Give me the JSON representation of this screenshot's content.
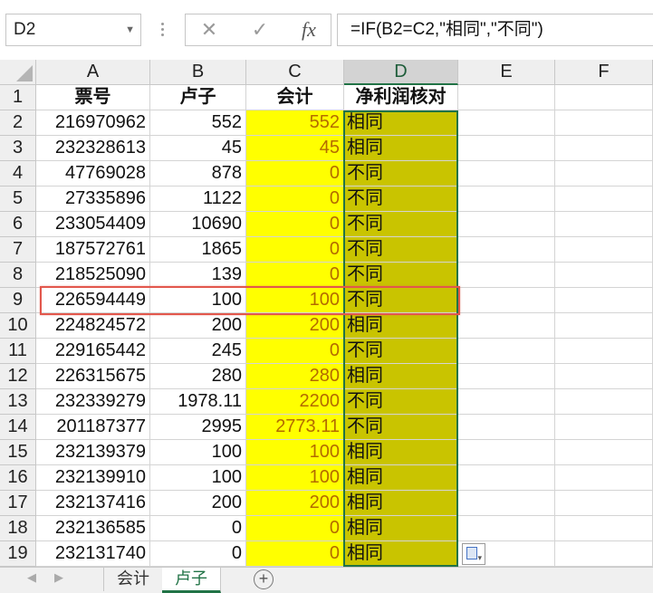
{
  "name_box": "D2",
  "formula_buttons": {
    "cancel": "✕",
    "enter": "✓",
    "fx": "fx"
  },
  "formula": "=IF(B2=C2,\"相同\",\"不同\")",
  "columns": [
    "A",
    "B",
    "C",
    "D",
    "E",
    "F"
  ],
  "headers": {
    "A": "票号",
    "B": "卢子",
    "C": "会计",
    "D": "净利润核对"
  },
  "rows": [
    {
      "n": "2",
      "a": "216970962",
      "b": "552",
      "c": "552",
      "d": "相同"
    },
    {
      "n": "3",
      "a": "232328613",
      "b": "45",
      "c": "45",
      "d": "相同"
    },
    {
      "n": "4",
      "a": "47769028",
      "b": "878",
      "c": "0",
      "d": "不同"
    },
    {
      "n": "5",
      "a": "27335896",
      "b": "1122",
      "c": "0",
      "d": "不同"
    },
    {
      "n": "6",
      "a": "233054409",
      "b": "10690",
      "c": "0",
      "d": "不同"
    },
    {
      "n": "7",
      "a": "187572761",
      "b": "1865",
      "c": "0",
      "d": "不同"
    },
    {
      "n": "8",
      "a": "218525090",
      "b": "139",
      "c": "0",
      "d": "不同"
    },
    {
      "n": "9",
      "a": "226594449",
      "b": "100",
      "c": "100",
      "d": "不同"
    },
    {
      "n": "10",
      "a": "224824572",
      "b": "200",
      "c": "200",
      "d": "相同"
    },
    {
      "n": "11",
      "a": "229165442",
      "b": "245",
      "c": "0",
      "d": "不同"
    },
    {
      "n": "12",
      "a": "226315675",
      "b": "280",
      "c": "280",
      "d": "相同"
    },
    {
      "n": "13",
      "a": "232339279",
      "b": "1978.11",
      "c": "2200",
      "d": "不同"
    },
    {
      "n": "14",
      "a": "201187377",
      "b": "2995",
      "c": "2773.11",
      "d": "不同"
    },
    {
      "n": "15",
      "a": "232139379",
      "b": "100",
      "c": "100",
      "d": "相同"
    },
    {
      "n": "16",
      "a": "232139910",
      "b": "100",
      "c": "100",
      "d": "相同"
    },
    {
      "n": "17",
      "a": "232137416",
      "b": "200",
      "c": "200",
      "d": "相同"
    },
    {
      "n": "18",
      "a": "232136585",
      "b": "0",
      "c": "0",
      "d": "相同"
    },
    {
      "n": "19",
      "a": "232131740",
      "b": "0",
      "c": "0",
      "d": "相同"
    }
  ],
  "header_row_number": "1",
  "sheet_tabs": [
    {
      "label": "会计",
      "active": false
    },
    {
      "label": "卢子",
      "active": true
    }
  ],
  "add_sheet": "+",
  "colors": {
    "yellow_fill": "#ffff00",
    "olive_fill": "#c9c400",
    "accent": "#217346",
    "highlight_border": "#e2574c",
    "number_text": "#b36b00"
  }
}
